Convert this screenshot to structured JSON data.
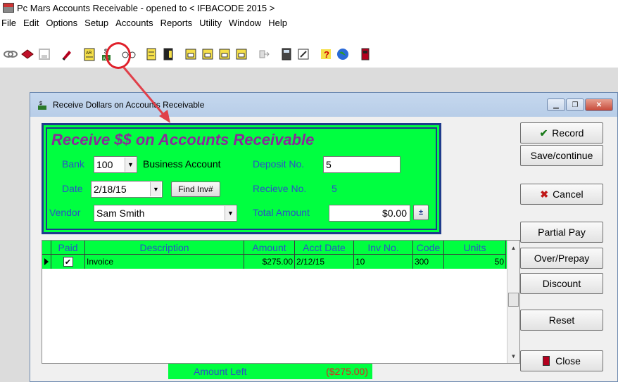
{
  "app": {
    "title": "Pc Mars Accounts Receivable - opened to < IFBACODE 2015 >"
  },
  "menu": [
    "File",
    "Edit",
    "Options",
    "Setup",
    "Accounts",
    "Reports",
    "Utility",
    "Window",
    "Help"
  ],
  "toolbar_icons": [
    "link-icon",
    "book-icon",
    "save-icon",
    "pen-icon",
    "ar-entry-icon",
    "ar-dollar-icon",
    "glasses-icon",
    "cabinet-icon",
    "cabinet-2-icon",
    "print-1-icon",
    "print-2-icon",
    "print-3-icon",
    "print-4-icon",
    "export-icon",
    "calculator-icon",
    "notepad-icon",
    "help-icon",
    "globe-icon",
    "exit-icon"
  ],
  "child": {
    "title": "Receive Dollars on Accounts Receivable",
    "heading": "Receive $$ on Accounts Receivable",
    "bank_label": "Bank",
    "bank_value": "100",
    "bank_name": "Business Account",
    "deposit_label": "Deposit No.",
    "deposit_value": "5",
    "date_label": "Date",
    "date_value": "2/18/15",
    "find_inv_label": "Find Inv#",
    "receive_no_label": "Recieve No.",
    "receive_no_value": "5",
    "vendor_label": "Vendor",
    "vendor_value": "Sam Smith",
    "total_amount_label": "Total Amount",
    "total_amount_value": "$0.00"
  },
  "side_buttons": {
    "record": "Record",
    "save_continue": "Save/continue",
    "cancel": "Cancel",
    "partial_pay": "Partial Pay",
    "over_prepay": "Over/Prepay",
    "discount": "Discount",
    "reset": "Reset",
    "close": "Close"
  },
  "grid": {
    "columns": [
      "Paid",
      "Description",
      "Amount",
      "Acct Date",
      "Inv No.",
      "Code",
      "Units"
    ],
    "rows": [
      {
        "paid": "✔",
        "description": "Invoice",
        "amount": "$275.00",
        "acct_date": "2/12/15",
        "inv_no": "10",
        "code": "300",
        "units": "50"
      }
    ]
  },
  "footer": {
    "amount_left_label": "Amount Left",
    "amount_left_value": "($275.00)"
  }
}
